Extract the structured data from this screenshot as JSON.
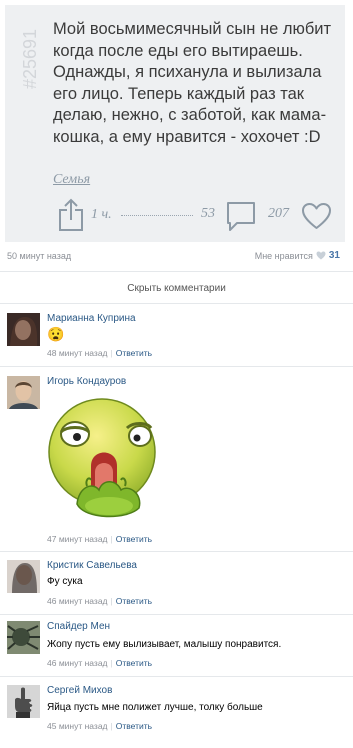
{
  "post": {
    "id": "#25691",
    "text": "Мой восьмимесячный сын не любит когда после еды его вытираешь. Однажды, я психанула и вылизала его лицо. Теперь каждый раз так делаю, нежно, с заботой, как мама-кошка, а ему нравится - хохочет :D",
    "tag": "Семья",
    "time": "1 ч.",
    "comments_count": "53",
    "likes_count": "207"
  },
  "meta": {
    "posted": "50 минут назад",
    "likes_label": "Мне нравится",
    "likes_count": "31"
  },
  "hide_comments": "Скрыть комментарии",
  "comments": [
    {
      "name": "Марианна Куприна",
      "text": "😧",
      "time": "48 минут назад",
      "reply": "Ответить"
    },
    {
      "name": "Игорь Кондауров",
      "text": "",
      "time": "47 минут назад",
      "reply": "Ответить"
    },
    {
      "name": "Кристик Савельева",
      "text": "Фу сука",
      "time": "46 минут назад",
      "reply": "Ответить"
    },
    {
      "name": "Спайдер Мен",
      "text": "Жопу пусть ему вылизывает, малышу понравится.",
      "time": "46 минут назад",
      "reply": "Ответить"
    },
    {
      "name": "Сергей Михов",
      "text": "Яйца пусть мне полижет лучше, толку больше",
      "time": "45 минут назад",
      "reply": "Ответить"
    }
  ]
}
